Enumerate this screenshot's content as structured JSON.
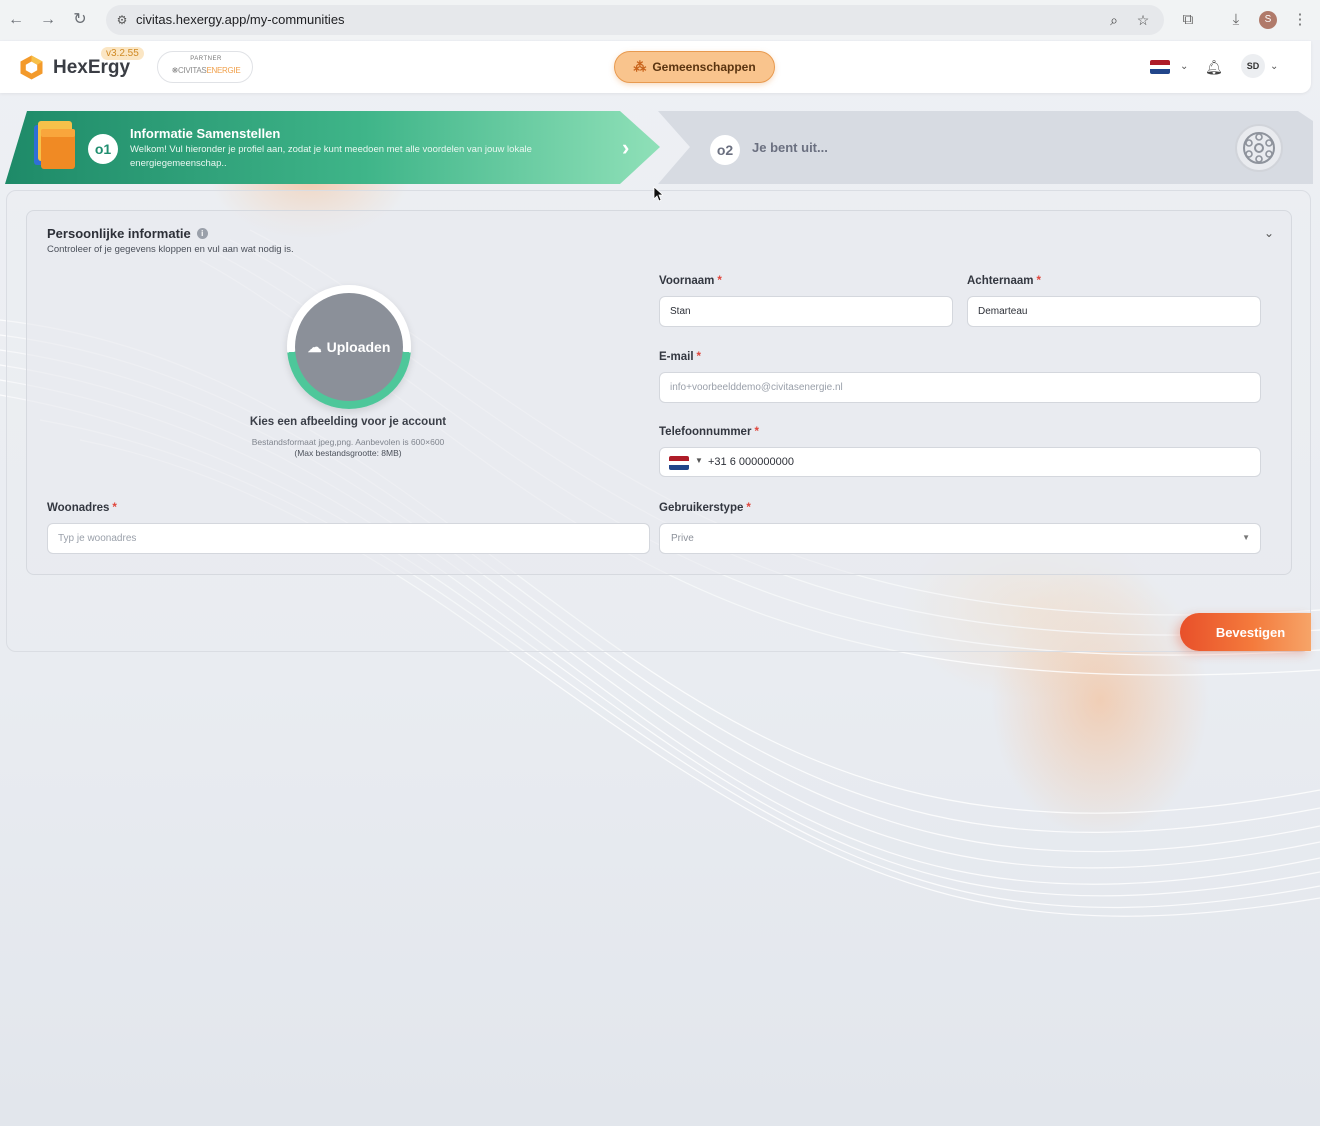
{
  "browser": {
    "url": "civitas.hexergy.app/my-communities",
    "profile_initial": "S"
  },
  "header": {
    "brand": "HexErgy",
    "version": "v3.2.55",
    "partner_label": "PARTNER",
    "partner_name_main": "CIVITAS",
    "partner_name_accent": "ENERGIE",
    "communities_button": "Gemeenschappen",
    "avatar_initials": "SD",
    "language_flag": "nl"
  },
  "stepper": {
    "step1": {
      "number": "o1",
      "title": "Informatie Samenstellen",
      "description": "Welkom! Vul hieronder je profiel aan, zodat je kunt meedoen met alle voordelen van jouw lokale energiegemeenschap.."
    },
    "step2": {
      "number": "o2",
      "title": "Je bent uit..."
    }
  },
  "form": {
    "title": "Persoonlijke informatie",
    "subtitle": "Controleer of je gegevens kloppen en vul aan wat nodig is.",
    "upload": {
      "button": "Uploaden",
      "caption": "Kies een afbeelding voor je account",
      "hint_format": "Bestandsformaat jpeg,png. Aanbevolen is 600×600",
      "hint_size": "(Max bestandsgrootte: 8MB)"
    },
    "first_name": {
      "label": "Voornaam",
      "value": "Stan"
    },
    "last_name": {
      "label": "Achternaam",
      "value": "Demarteau"
    },
    "email": {
      "label": "E-mail",
      "placeholder": "info+voorbeelddemo@civitasenergie.nl"
    },
    "phone": {
      "label": "Telefoonnummer",
      "value": "+31 6 000000000"
    },
    "address": {
      "label": "Woonadres",
      "placeholder": "Typ je woonadres"
    },
    "user_type": {
      "label": "Gebruikerstype",
      "value": "Prive"
    },
    "required_marker": "*"
  },
  "actions": {
    "confirm": "Bevestigen"
  },
  "colors": {
    "accent_orange": "#f47a3c",
    "step_green": "#1f8e6f",
    "required_red": "#e0453b"
  }
}
